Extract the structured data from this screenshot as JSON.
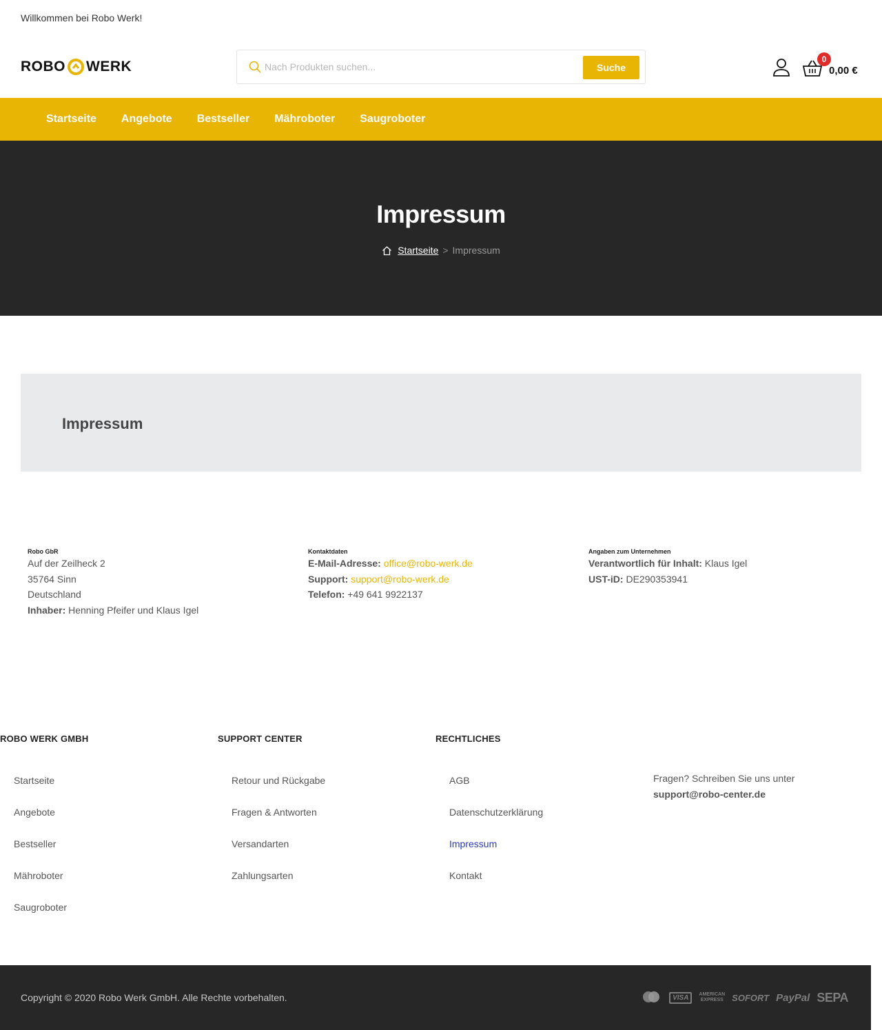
{
  "topbar": {
    "welcome": "Willkommen bei Robo Werk!"
  },
  "header": {
    "logo_left": "ROBO",
    "logo_right": "WERK",
    "search_placeholder": "Nach Produkten suchen...",
    "search_button": "Suche",
    "cart_count": "0",
    "cart_total": "0,00 €"
  },
  "nav": [
    "Startseite",
    "Angebote",
    "Bestseller",
    "Mähroboter",
    "Saugroboter"
  ],
  "hero": {
    "title": "Impressum",
    "breadcrumb_home": "Startseite",
    "breadcrumb_sep": ">",
    "breadcrumb_current": "Impressum"
  },
  "content": {
    "heading": "Impressum"
  },
  "company": {
    "title": "Robo GbR",
    "street": "Auf der Zeilheck 2",
    "city": "35764 Sinn",
    "country": "Deutschland",
    "owner_label": "Inhaber:",
    "owner_value": "Henning Pfeifer und Klaus Igel"
  },
  "contact": {
    "title": "Kontaktdaten",
    "email_label": "E-Mail-Adresse:",
    "email_value": "office@robo-werk.de",
    "support_label": "Support:",
    "support_value": "support@robo-werk.de",
    "phone_label": "Telefon:",
    "phone_value": "+49 641 9922137"
  },
  "firm": {
    "title": "Angaben zum Unternehmen",
    "resp_label": "Verantwortlich für Inhalt:",
    "resp_value": "Klaus Igel",
    "ust_label": "UST-iD:",
    "ust_value": "DE290353941"
  },
  "footer": {
    "col1": {
      "title": "ROBO WERK GMBH",
      "items": [
        "Startseite",
        "Angebote",
        "Bestseller",
        "Mähroboter",
        "Saugroboter"
      ]
    },
    "col2": {
      "title": "SUPPORT CENTER",
      "items": [
        "Retour und Rückgabe",
        "Fragen & Antworten",
        "Versandarten",
        "Zahlungsarten"
      ]
    },
    "col3": {
      "title": "RECHTLICHES",
      "items": [
        "AGB",
        "Datenschutzerklärung",
        "Impressum",
        "Kontakt"
      ]
    },
    "question": "Fragen? Schreiben Sie uns unter",
    "question_email": "support@robo-center.de",
    "copyright": "Copyright © 2020 Robo Werk GmbH. Alle Rechte vorbehalten.",
    "payments": {
      "visa": "VISA",
      "amex_1": "AMERICAN",
      "amex_2": "EXPRESS",
      "sofort": "SOFORT",
      "paypal": "PayPal",
      "sepa": "SEPA"
    }
  },
  "colors": {
    "accent": "#e8b505",
    "dark": "#272727",
    "badge": "#e02b2b",
    "active_link": "#2a3bb7"
  }
}
